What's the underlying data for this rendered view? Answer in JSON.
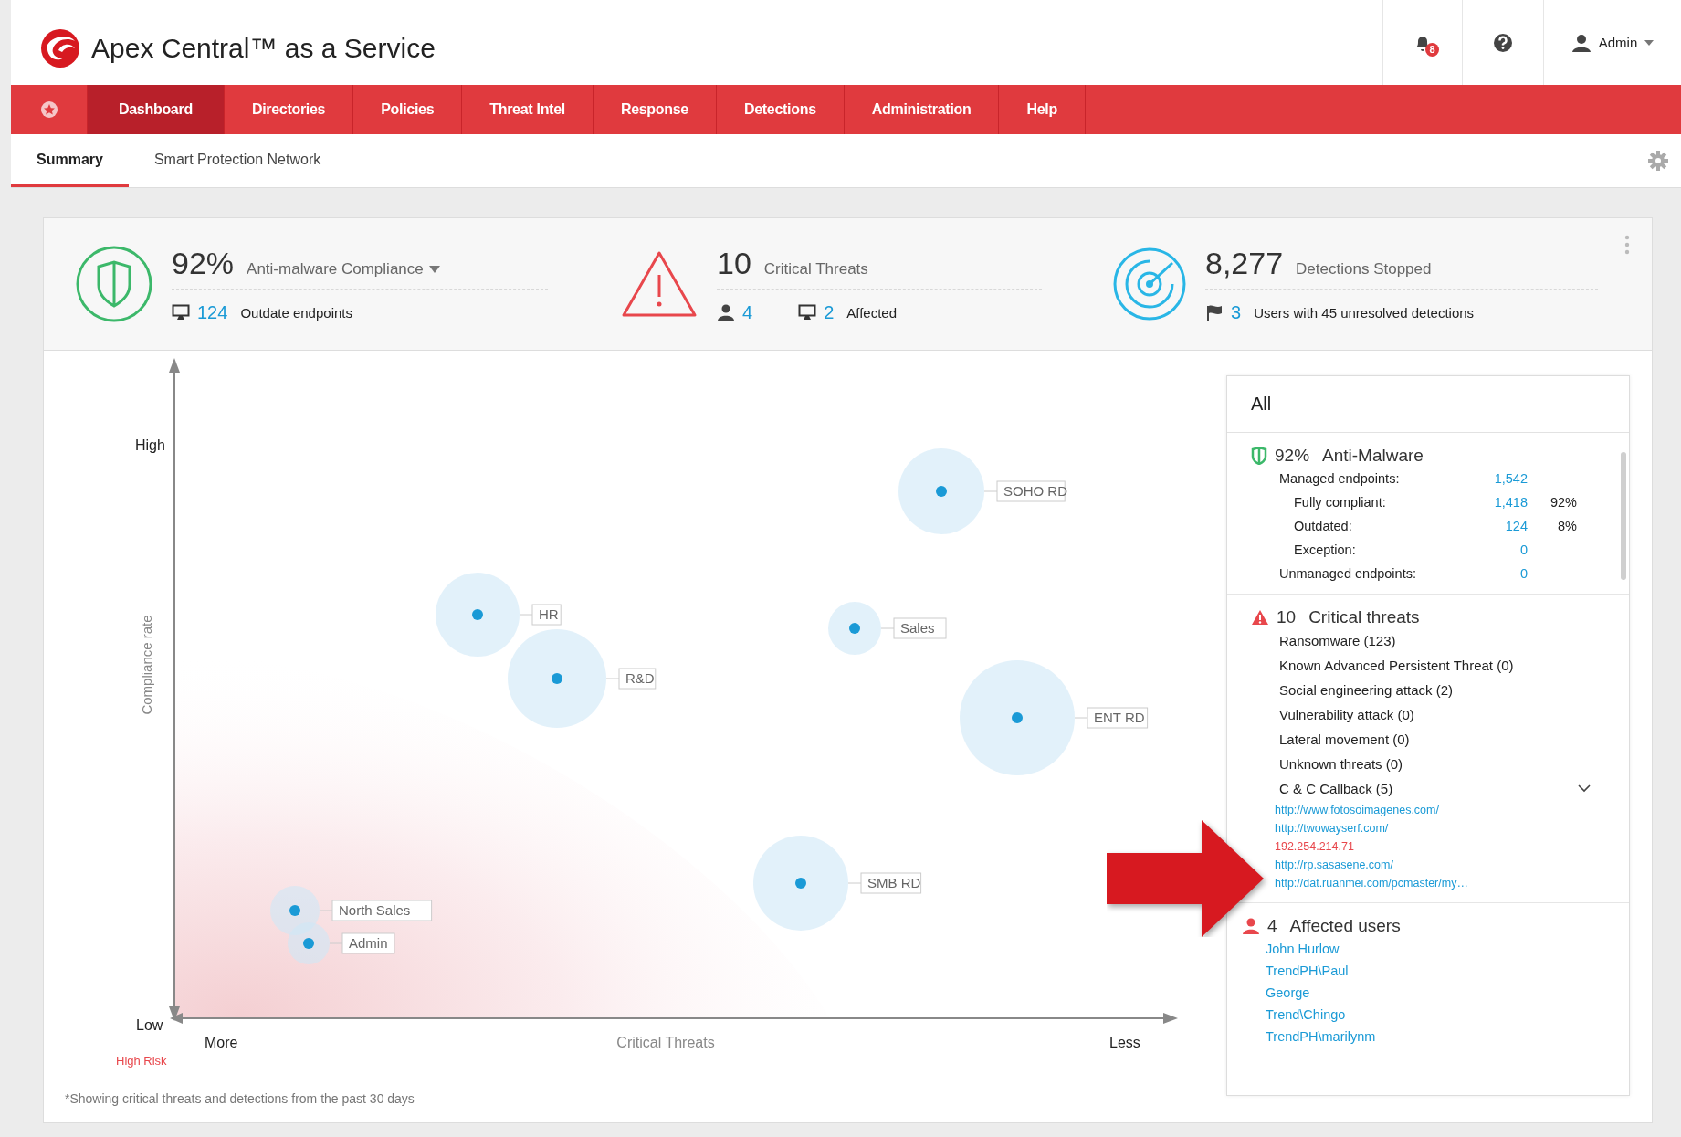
{
  "app": {
    "title": "Apex Central™ as a Service",
    "notifications": "8",
    "user": "Admin"
  },
  "nav": [
    {
      "label": "Dashboard",
      "selected": true
    },
    {
      "label": "Directories",
      "selected": false
    },
    {
      "label": "Policies",
      "selected": false
    },
    {
      "label": "Threat Intel",
      "selected": false
    },
    {
      "label": "Response",
      "selected": false
    },
    {
      "label": "Detections",
      "selected": false
    },
    {
      "label": "Administration",
      "selected": false
    },
    {
      "label": "Help",
      "selected": false
    }
  ],
  "subtabs": [
    {
      "label": "Summary",
      "selected": true
    },
    {
      "label": "Smart Protection Network",
      "selected": false
    }
  ],
  "compliance": {
    "value": "92%",
    "label": "Anti-malware Compliance",
    "count": "124",
    "count_label": "Outdate endpoints"
  },
  "threats": {
    "value": "10",
    "label": "Critical Threats",
    "users": "4",
    "endpoints": "2",
    "endpoints_label": "Affected"
  },
  "detections": {
    "value": "8,277",
    "label": "Detections Stopped",
    "users": "3",
    "users_label": "Users with 45 unresolved detections"
  },
  "chart": {
    "y_high": "High",
    "y_low": "Low",
    "y_title": "Compliance rate",
    "x_more": "More",
    "x_title": "Critical Threats",
    "x_less": "Less",
    "risk_label": "High Risk",
    "groups": [
      {
        "label": "SOHO RD"
      },
      {
        "label": "HR"
      },
      {
        "label": "R&D"
      },
      {
        "label": "Sales"
      },
      {
        "label": "ENT RD"
      },
      {
        "label": "SMB RD"
      },
      {
        "label": "North Sales"
      },
      {
        "label": "Admin"
      }
    ],
    "footnote": "*Showing critical threats and detections from the past 30 days"
  },
  "panel": {
    "filter": "All",
    "anti_malware": {
      "value": "92%",
      "label": "Anti-Malware",
      "rows": [
        {
          "kind": "top",
          "label": "Managed endpoints:",
          "value": "1,542"
        },
        {
          "kind": "sub",
          "label": "Fully compliant:",
          "value": "1,418",
          "share": "92%"
        },
        {
          "kind": "sub",
          "label": "Outdated:",
          "value": "124",
          "share": "8%"
        },
        {
          "kind": "sub",
          "label": "Exception:",
          "value": "0"
        },
        {
          "kind": "top",
          "label": "Unmanaged endpoints:",
          "value": "0"
        }
      ]
    },
    "threats": {
      "value": "10",
      "label": "Critical threats",
      "items": [
        {
          "label": "Ransomware (123)",
          "expanded": false
        },
        {
          "label": "Known Advanced Persistent Threat (0)",
          "expanded": false
        },
        {
          "label": "Social engineering attack (2)",
          "expanded": false
        },
        {
          "label": "Vulnerability attack (0)",
          "expanded": false
        },
        {
          "label": "Lateral movement (0)",
          "expanded": false
        },
        {
          "label": "Unknown threats (0)",
          "expanded": false
        },
        {
          "label": "C & C Callback (5)",
          "expanded": true
        }
      ],
      "callbacks": [
        {
          "kind": "link",
          "text": "http://www.fotosoimagenes.com/"
        },
        {
          "kind": "link",
          "text": "http://twowayserf.com/"
        },
        {
          "kind": "alert",
          "text": "192.254.214.71"
        },
        {
          "kind": "link",
          "text": "http://rp.sasasene.com/"
        },
        {
          "kind": "link",
          "text": "http://dat.ruanmei.com/pcmaster/my…"
        }
      ]
    },
    "users": {
      "value": "4",
      "label": "Affected users",
      "names": [
        "John Hurlow",
        "TrendPH\\Paul",
        "George",
        "Trend\\Chingo",
        "TrendPH\\marilynm"
      ]
    }
  }
}
